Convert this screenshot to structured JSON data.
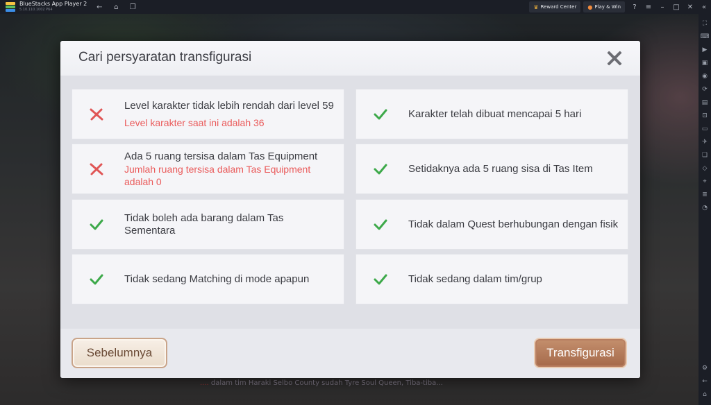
{
  "titlebar": {
    "app_name": "BlueStacks App Player 2",
    "version": "5.10.110.1002 P64",
    "reward_center": "Reward Center",
    "play_win": "Play & Win"
  },
  "dialog": {
    "title": "Cari persyaratan transfigurasi",
    "conditions": [
      {
        "text": "Level karakter tidak lebih rendah dari level 59",
        "met": false,
        "note": "Level karakter saat ini adalah 36"
      },
      {
        "text": "Karakter telah dibuat mencapai 5 hari",
        "met": true,
        "note": ""
      },
      {
        "text": "Ada 5 ruang tersisa dalam Tas Equipment",
        "met": false,
        "note": "Jumlah ruang tersisa dalam Tas Equipment adalah 0"
      },
      {
        "text": "Setidaknya ada 5 ruang sisa di Tas Item",
        "met": true,
        "note": ""
      },
      {
        "text": "Tidak boleh ada barang dalam Tas Sementara",
        "met": true,
        "note": ""
      },
      {
        "text": "Tidak dalam Quest berhubungan dengan fisik",
        "met": true,
        "note": ""
      },
      {
        "text": "Tidak sedang Matching di mode apapun",
        "met": true,
        "note": ""
      },
      {
        "text": "Tidak sedang dalam tim/grup",
        "met": true,
        "note": ""
      }
    ],
    "prev_label": "Sebelumnya",
    "next_label": "Transfigurasi"
  },
  "background_text": {
    "name": "....",
    "message": "dalam tim Haraki Selbo County sudah Tyre Soul Queen, Tiba-tiba..."
  },
  "colors": {
    "fail": "#e05555",
    "pass": "#3da94a",
    "note": "#ea5a5a"
  }
}
